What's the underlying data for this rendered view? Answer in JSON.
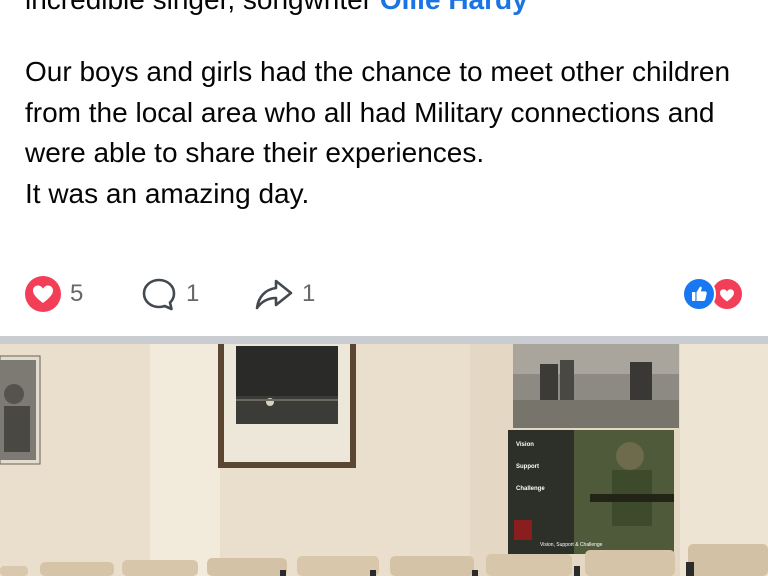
{
  "post": {
    "cut_line_text": "incredible singer, songwriter ",
    "cut_line_mention": "Ollie Hardy",
    "body_lines": [
      "Our boys and girls had the chance to meet other children from the local area who all had Military connections and were able to share their experiences.",
      "It was an amazing day."
    ]
  },
  "actions": {
    "like_icon": "heart-icon",
    "like_count": "5",
    "comment_icon": "comment-icon",
    "comment_count": "1",
    "share_icon": "share-arrow-icon",
    "share_count": "1",
    "summary_icons": [
      "thumbs-up-icon",
      "heart-icon"
    ]
  },
  "photo": {
    "poster_lines": [
      "Vision",
      "Support",
      "Challenge",
      "Vision, Support & Challenge"
    ]
  },
  "colors": {
    "mention": "#1b74e4",
    "like_red": "#f33e58",
    "like_blue": "#1877f2",
    "divider": "#c9ccd1",
    "text": "#050505",
    "meta": "#65676b"
  }
}
